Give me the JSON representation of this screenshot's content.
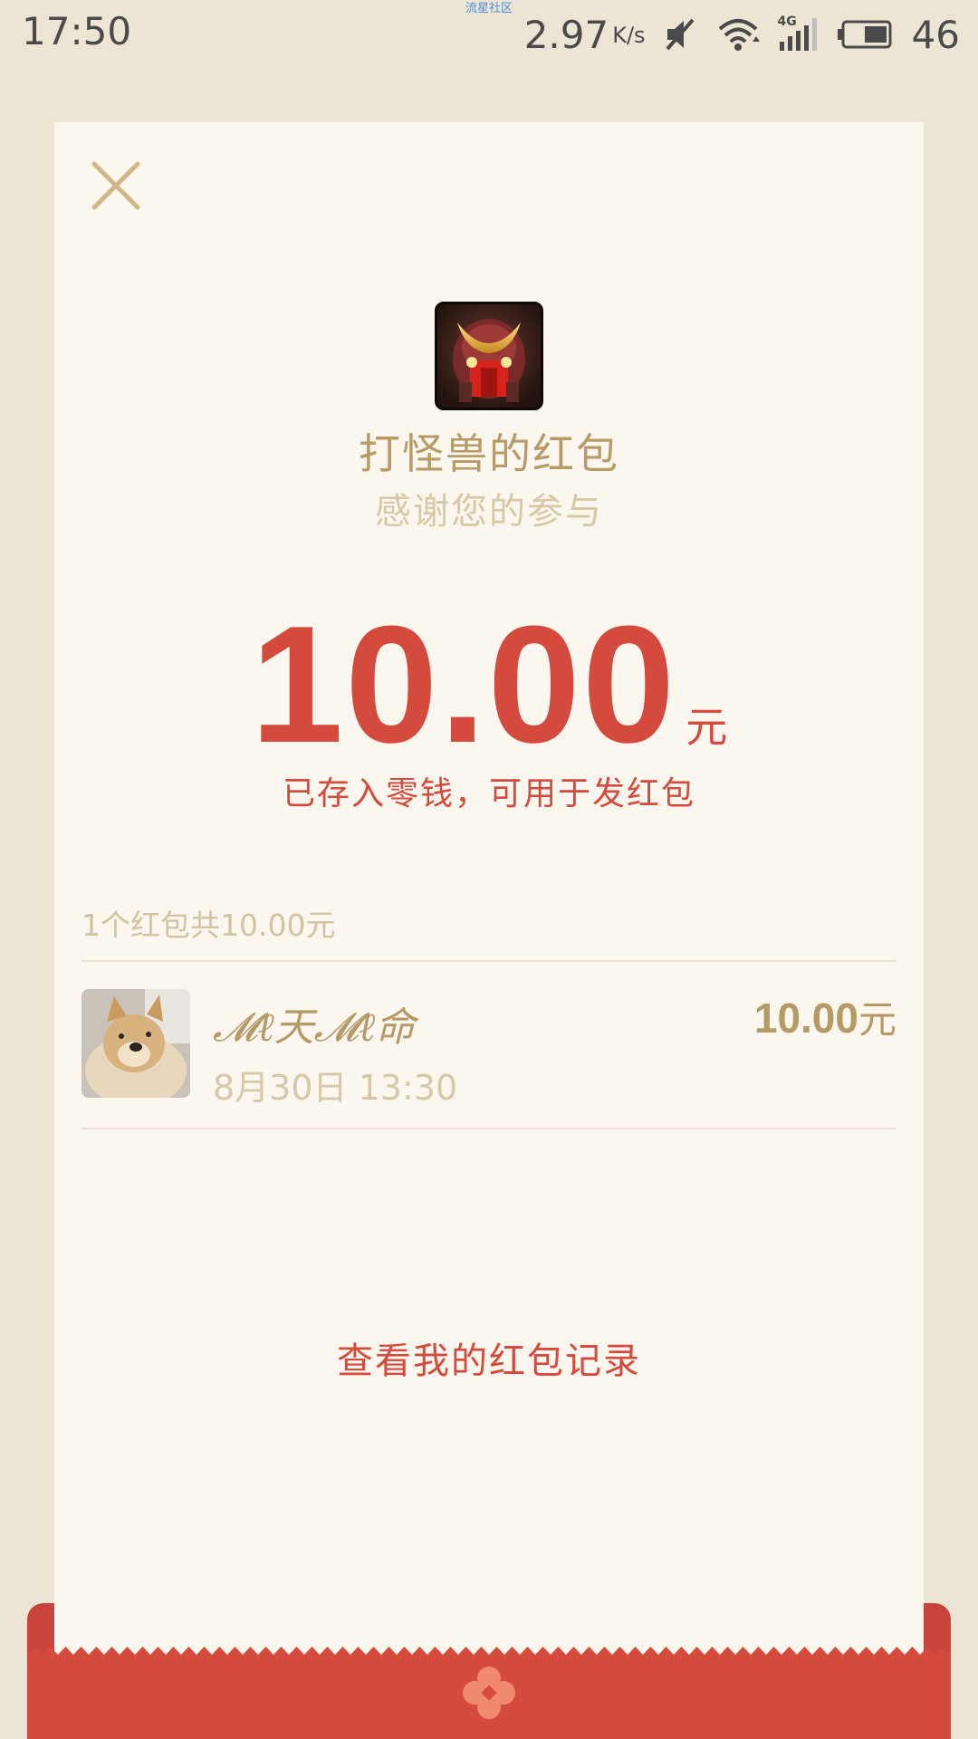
{
  "status_bar": {
    "time": "17:50",
    "notice": "流星社区",
    "net_speed": "2.97",
    "net_unit": "K/s",
    "network_type": "4G",
    "battery_level": "46",
    "icons": [
      "mute-icon",
      "wifi-icon",
      "signal-icon",
      "battery-icon"
    ]
  },
  "card": {
    "close_icon": "close-icon",
    "sender_avatar": "game-logo",
    "sender_title": "打怪兽的红包",
    "sender_subtitle": "感谢您的参与",
    "amount": "10.00",
    "amount_unit": "元",
    "amount_note": "已存入零钱，可用于发红包",
    "summary": "1个红包共10.00元",
    "records": [
      {
        "name": "𝓜ℓ天𝓜ℓ命",
        "time": "8月30日  13:30",
        "amount": "10.00",
        "unit": "元"
      }
    ],
    "history_link": "查看我的红包记录"
  },
  "colors": {
    "page_bg": "#ede5d4",
    "card_bg": "#fbf7ee",
    "gold": "#b79a66",
    "light_gold": "#d9c8a6",
    "red": "#d44a3d",
    "envelope_red": "#d44a3d"
  }
}
